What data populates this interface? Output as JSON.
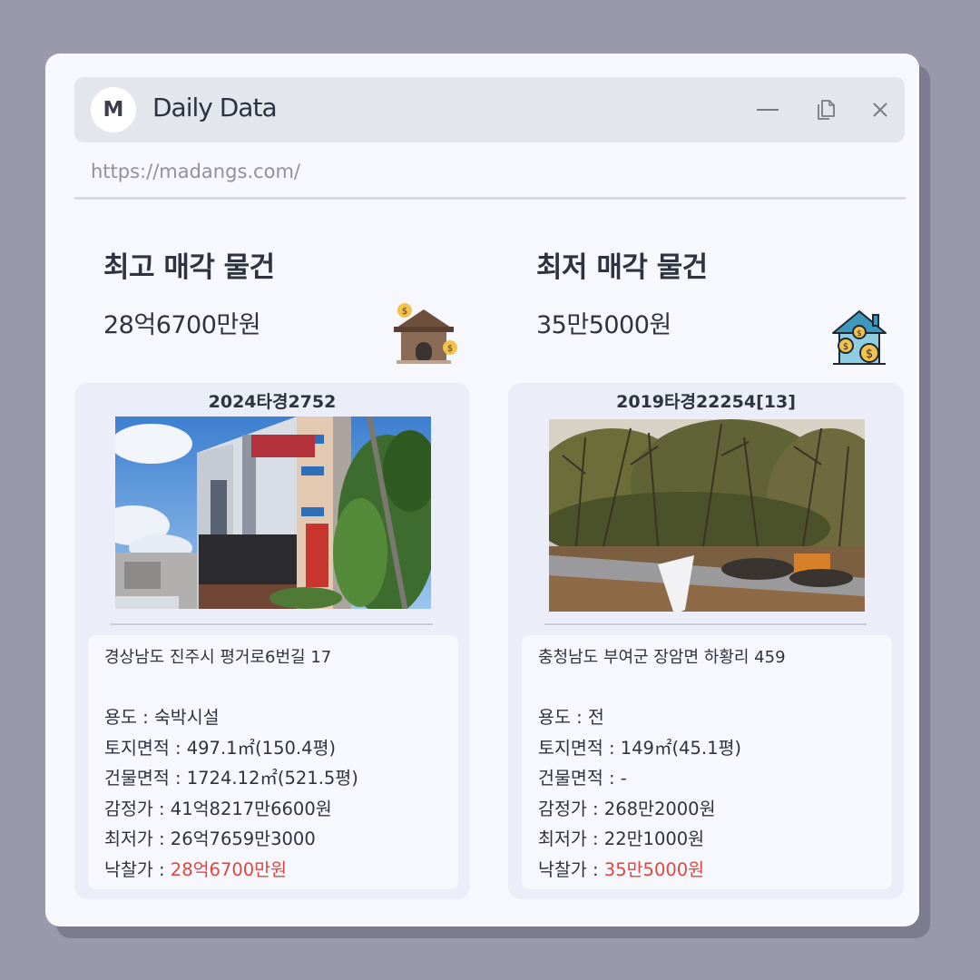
{
  "window": {
    "logo_letter": "M",
    "title": "Daily Data",
    "url": "https://madangs.com/"
  },
  "icons": {
    "minimize": "minimize-icon",
    "restore": "restore-icon",
    "close": "close-icon",
    "highest": "house-with-coins-icon",
    "lowest": "house-with-coins-icon"
  },
  "colors": {
    "accent_red": "#e0463f",
    "background": "#9999ab",
    "window": "#f7f8fd"
  },
  "highest": {
    "heading": "최고 매각 물건",
    "price": "28억6700만원",
    "case_no": "2024타경2752",
    "address": "경상남도 진주시 평거로6번길 17",
    "usage_label": "용도 : ",
    "usage": "숙박시설",
    "land_label": "토지면적 : ",
    "land": "497.1㎡(150.4평)",
    "building_label": "건물면적 : ",
    "building": "1724.12㎡(521.5평)",
    "appraisal_label": "감정가 : ",
    "appraisal": "41억8217만6600원",
    "minimum_label": "최저가 : ",
    "minimum": "26억7659만3000",
    "winning_label": "낙찰가 : ",
    "winning": "28억6700만원"
  },
  "lowest": {
    "heading": "최저 매각 물건",
    "price": "35만5000원",
    "case_no": "2019타경22254[13]",
    "address": "충청남도 부여군 장암면 하황리 459",
    "usage_label": "용도 : ",
    "usage": "전",
    "land_label": "토지면적 : ",
    "land": "149㎡(45.1평)",
    "building_label": "건물면적 : ",
    "building": "-",
    "appraisal_label": "감정가 : ",
    "appraisal": "268만2000원",
    "minimum_label": "최저가 : ",
    "minimum": "22만1000원",
    "winning_label": "낙찰가 : ",
    "winning": "35만5000원"
  }
}
